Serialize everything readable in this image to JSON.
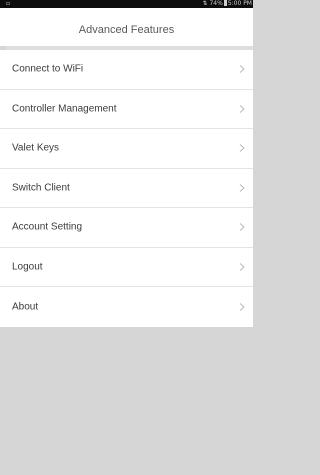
{
  "status_bar": {
    "left_icon": "image-icon",
    "battery_text": "74%",
    "time": "5:00 PM",
    "icons": [
      "signal-icon",
      "battery-icon"
    ]
  },
  "header": {
    "title": "Advanced Features"
  },
  "menu": {
    "items": [
      {
        "label": "Connect to WiFi"
      },
      {
        "label": "Controller Management"
      },
      {
        "label": "Valet Keys"
      },
      {
        "label": "Switch Client"
      },
      {
        "label": "Account Setting"
      },
      {
        "label": "Logout"
      },
      {
        "label": "About"
      }
    ],
    "chevron_icon": "chevron-right-icon"
  },
  "colors": {
    "status_bar_bg": "#0d0d0d",
    "page_bg": "#d6d6d6",
    "header_bg": "#ffffff",
    "title_text": "#5a5a5a",
    "item_text": "#3c3c3c",
    "chevron": "#b5b5b5",
    "divider": "#e3e3e3"
  }
}
